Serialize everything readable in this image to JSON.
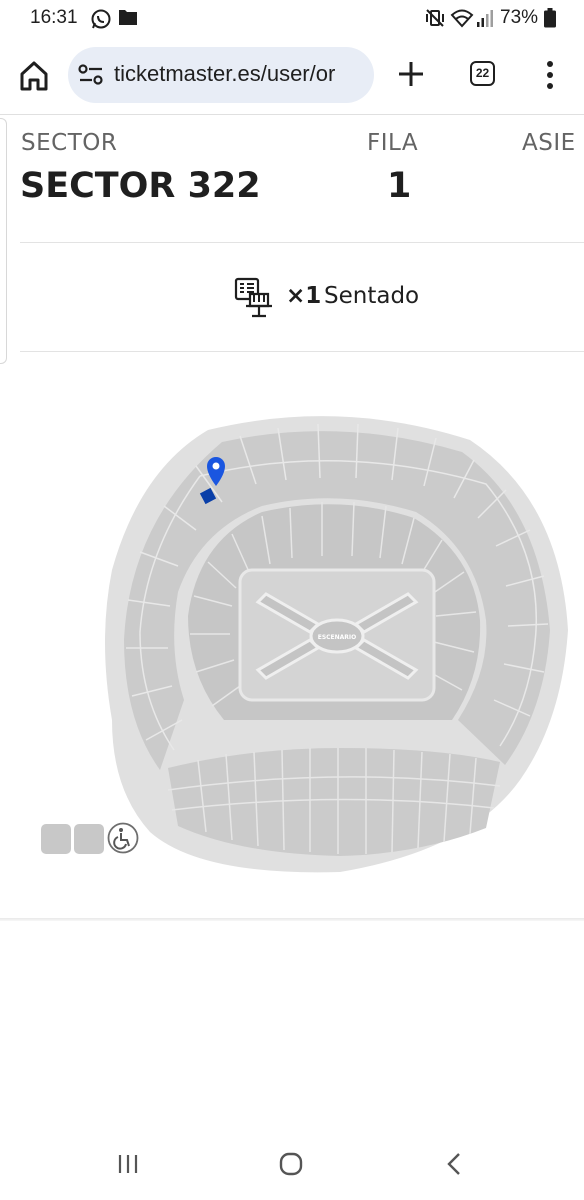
{
  "status_bar": {
    "time": "16:31",
    "battery": "73%",
    "icons": [
      "whatsapp-icon",
      "folder-icon",
      "mute-vibrate-icon",
      "wifi-icon",
      "signal-icon",
      "battery-icon"
    ]
  },
  "browser": {
    "url": "ticketmaster.es/user/or",
    "tab_count": "22",
    "icons": [
      "home-icon",
      "site-settings-icon",
      "plus-icon",
      "tabs-icon",
      "more-vert-icon"
    ]
  },
  "ticket": {
    "sector_label": "SECTOR",
    "sector_value": "SECTOR 322",
    "row_label": "FILA",
    "row_value": "1",
    "seat_label": "ASIE",
    "quantity": "×1",
    "seat_type": "Sentado"
  },
  "map": {
    "stage_label": "ESCENARIO",
    "accent_color": "#0a3fa8",
    "section_color": "#c8c8c8",
    "outline_color": "#dedede"
  },
  "nav": {
    "icons": [
      "recents-icon",
      "home-circle-icon",
      "back-icon"
    ]
  }
}
